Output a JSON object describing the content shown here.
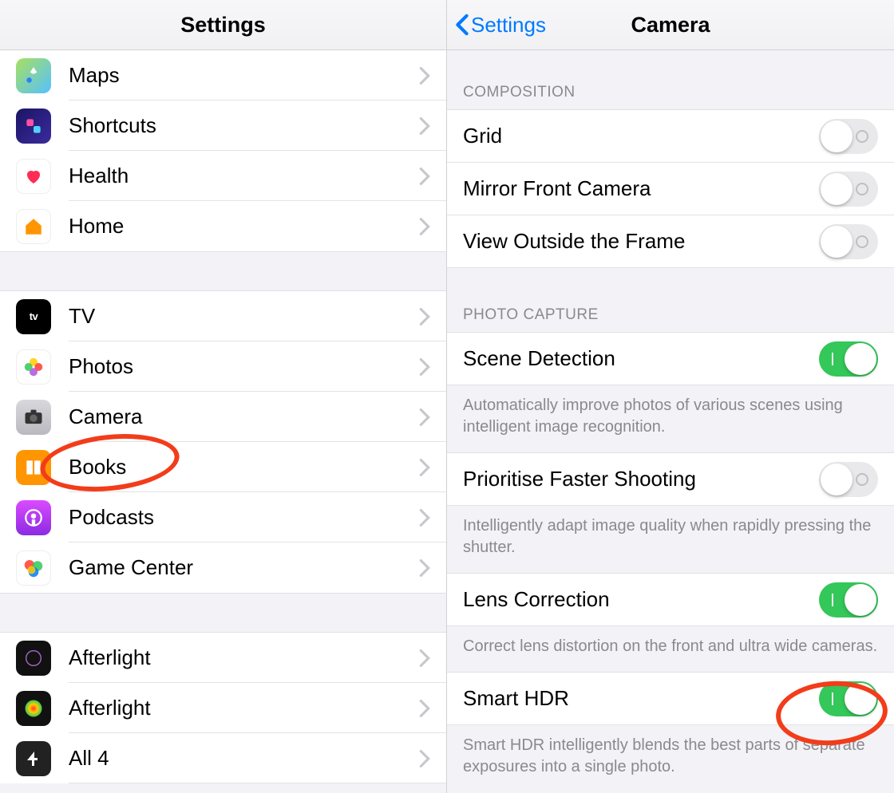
{
  "left": {
    "title": "Settings",
    "groups": [
      [
        {
          "key": "maps",
          "label": "Maps",
          "icon": "maps-icon"
        },
        {
          "key": "shortcuts",
          "label": "Shortcuts",
          "icon": "shortcuts-icon"
        },
        {
          "key": "health",
          "label": "Health",
          "icon": "health-icon"
        },
        {
          "key": "home",
          "label": "Home",
          "icon": "home-icon"
        }
      ],
      [
        {
          "key": "tv",
          "label": "TV",
          "icon": "tv-icon"
        },
        {
          "key": "photos",
          "label": "Photos",
          "icon": "photos-icon"
        },
        {
          "key": "camera",
          "label": "Camera",
          "icon": "camera-icon",
          "highlighted": true
        },
        {
          "key": "books",
          "label": "Books",
          "icon": "books-icon"
        },
        {
          "key": "podcasts",
          "label": "Podcasts",
          "icon": "podcasts-icon"
        },
        {
          "key": "gamecenter",
          "label": "Game Center",
          "icon": "gamecenter-icon"
        }
      ],
      [
        {
          "key": "afterlight1",
          "label": "Afterlight",
          "icon": "afterlight-icon"
        },
        {
          "key": "afterlight2",
          "label": "Afterlight",
          "icon": "afterlight2-icon"
        },
        {
          "key": "all4",
          "label": "All 4",
          "icon": "all4-icon"
        }
      ]
    ]
  },
  "right": {
    "back_label": "Settings",
    "title": "Camera",
    "sections": [
      {
        "header": "COMPOSITION",
        "rows": [
          {
            "key": "grid",
            "label": "Grid",
            "toggle": false
          },
          {
            "key": "mirror",
            "label": "Mirror Front Camera",
            "toggle": false
          },
          {
            "key": "outside_frame",
            "label": "View Outside the Frame",
            "toggle": false
          }
        ]
      },
      {
        "header": "PHOTO CAPTURE",
        "rows": [
          {
            "key": "scene_detection",
            "label": "Scene Detection",
            "toggle": true,
            "footer": "Automatically improve photos of various scenes using intelligent image recognition."
          },
          {
            "key": "faster_shooting",
            "label": "Prioritise Faster Shooting",
            "toggle": false,
            "footer": "Intelligently adapt image quality when rapidly pressing the shutter."
          },
          {
            "key": "lens_correction",
            "label": "Lens Correction",
            "toggle": true,
            "footer": "Correct lens distortion on the front and ultra wide cameras."
          },
          {
            "key": "smart_hdr",
            "label": "Smart HDR",
            "toggle": true,
            "highlighted": true,
            "footer": "Smart HDR intelligently blends the best parts of separate exposures into a single photo."
          }
        ]
      }
    ]
  },
  "colors": {
    "accent": "#007aff",
    "toggle_on": "#34c759",
    "annotation": "#f23c1a"
  }
}
